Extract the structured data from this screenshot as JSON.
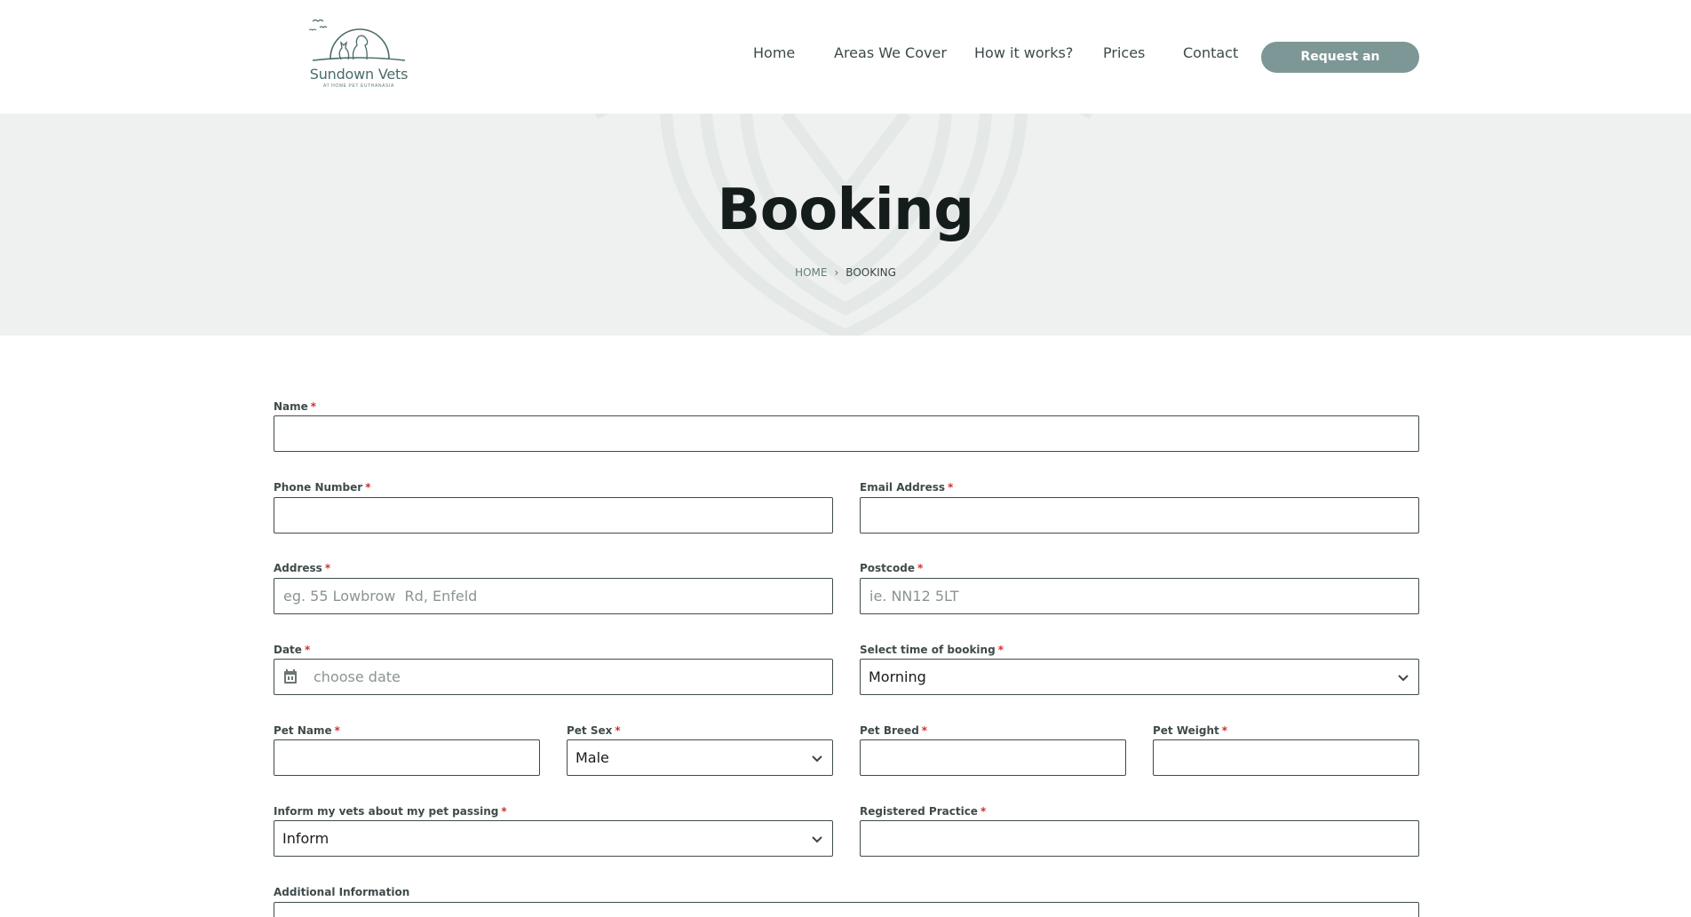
{
  "header": {
    "logo": {
      "name": "Sundown Vets",
      "tagline": "AT HOME PET EUTHANASIA"
    },
    "nav": [
      {
        "label": "Home"
      },
      {
        "label": "Areas We Cover"
      },
      {
        "label": "How it works?"
      },
      {
        "label": "Prices"
      },
      {
        "label": "Contact"
      }
    ],
    "cta_label": "Request an Appointment"
  },
  "hero": {
    "title": "Booking",
    "breadcrumb": {
      "home": "HOME",
      "separator": "›",
      "current": "BOOKING"
    }
  },
  "form": {
    "required_marker": "*",
    "name": {
      "label": "Name",
      "value": "",
      "placeholder": ""
    },
    "phone": {
      "label": "Phone Number",
      "value": "",
      "placeholder": ""
    },
    "email": {
      "label": "Email Address",
      "value": "",
      "placeholder": ""
    },
    "address": {
      "label": "Address",
      "value": "",
      "placeholder": "eg. 55 Lowbrow  Rd, Enfeld"
    },
    "postcode": {
      "label": "Postcode",
      "value": "",
      "placeholder": "ie. NN12 5LT"
    },
    "date": {
      "label": "Date",
      "value": "",
      "placeholder": "choose date"
    },
    "booking_time": {
      "label": "Select time of booking",
      "selected": "Morning"
    },
    "pet_name": {
      "label": "Pet Name",
      "value": "",
      "placeholder": ""
    },
    "pet_sex": {
      "label": "Pet Sex",
      "selected": "Male"
    },
    "pet_breed": {
      "label": "Pet Breed",
      "value": "",
      "placeholder": ""
    },
    "pet_weight": {
      "label": "Pet Weight",
      "value": "",
      "placeholder": ""
    },
    "inform_vets": {
      "label": "Inform my vets about my pet passing",
      "selected": "Inform"
    },
    "registered_practice": {
      "label": "Registered Practice",
      "value": "",
      "placeholder": ""
    },
    "additional_info": {
      "label": "Additional Information"
    }
  },
  "colors": {
    "accent": "#7d9796",
    "hero_bg": "#eff1f0",
    "required": "#d0312d",
    "text": "#3f4b4b"
  },
  "icons": [
    "birds-icon",
    "pets-logo-icon",
    "calendar-icon",
    "chevron-down-icon"
  ]
}
